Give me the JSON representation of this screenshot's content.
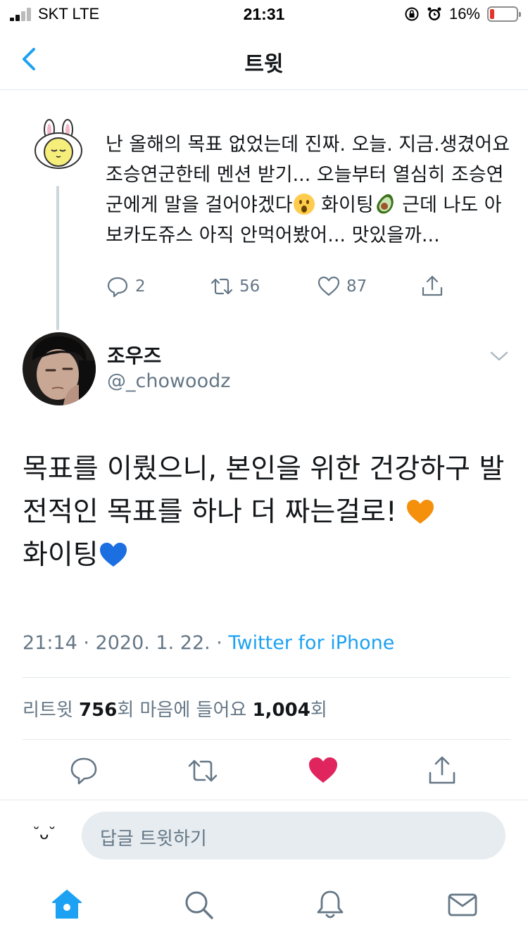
{
  "status_bar": {
    "carrier": "SKT   LTE",
    "time": "21:31",
    "battery_percent": "16%",
    "battery_level": 0.16,
    "battery_color": "#e4332d"
  },
  "nav": {
    "title": "트윗",
    "back_icon": "chevron-left-icon"
  },
  "parent_tweet": {
    "avatar_icon": "bunny-avatar-icon",
    "text_1": "난 올해의 목표 없었는데 진짜. 오늘. 지금.생겼어요 조승연군한테 멘션 받기... 오늘부터 열심히 조승연군에게 말을 걸어야겠다",
    "emoji_1": "surprised-face-icon",
    "text_2": " 화이팅",
    "emoji_2": "avocado-icon",
    "text_3": " 근데 나도 아보카도쥬스 아직 안먹어봤어... 맛있을까...",
    "replies": "2",
    "retweets": "56",
    "likes": "87"
  },
  "tweet": {
    "display_name": "조우즈",
    "handle": "@_chowoodz",
    "text_1": "목표를 이뤘으니, 본인을 위한 건강하구 발전적인 목표를 하나 더 짜는걸로! ",
    "emoji_1": "orange-heart-icon",
    "text_2": "화이팅",
    "emoji_2": "blue-heart-icon",
    "timestamp": "21:14 · 2020. 1. 22. · ",
    "source": "Twitter for iPhone",
    "retweet_label": "리트윗 ",
    "retweet_count": "756",
    "retweet_suffix": "회  ",
    "like_label": "마음에 들어요 ",
    "like_count": "1,004",
    "like_suffix": "회",
    "liked": true
  },
  "composer": {
    "face": "˘ᴗ˘",
    "placeholder": "답글 트윗하기"
  },
  "tabbar": {
    "items": [
      "home-icon",
      "search-icon",
      "notifications-icon",
      "messages-icon"
    ]
  },
  "colors": {
    "accent": "#1da1f2",
    "muted": "#657786",
    "like": "#e0245e",
    "divider": "#e1e8ed"
  }
}
